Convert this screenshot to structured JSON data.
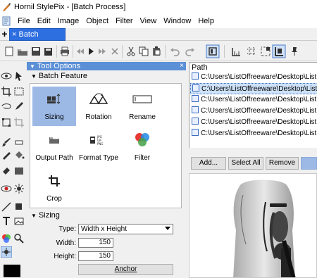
{
  "window": {
    "title": "Hornil StylePix - [Batch Process]"
  },
  "menu": {
    "items": [
      "File",
      "Edit",
      "Image",
      "Object",
      "Filter",
      "View",
      "Window",
      "Help"
    ]
  },
  "tabs": {
    "new_tab": "+",
    "active": "× Batch Process"
  },
  "tool_options": {
    "header": "Tool Options",
    "close": "×",
    "batch_feature_label": "Batch Feature",
    "features": [
      {
        "label": "Sizing",
        "icon": "sizing-icon",
        "selected": true
      },
      {
        "label": "Rotation",
        "icon": "rotation-icon",
        "selected": false
      },
      {
        "label": "Rename",
        "icon": "rename-icon",
        "selected": false
      },
      {
        "label": "Output Path",
        "icon": "folder-icon",
        "selected": false
      },
      {
        "label": "Format Type",
        "icon": "format-icon",
        "selected": false
      },
      {
        "label": "Filter",
        "icon": "filter-icon",
        "selected": false
      },
      {
        "label": "Crop",
        "icon": "crop-icon",
        "selected": false
      }
    ],
    "sizing_label": "Sizing",
    "type_label": "Type:",
    "type_value": "Width x Height",
    "width_label": "Width:",
    "width_value": "150",
    "height_label": "Height:",
    "height_value": "150",
    "anchor_label": "Anchor"
  },
  "file_list": {
    "header": "Path",
    "rows": [
      "C:\\Users\\ListOffreeware\\Desktop\\List",
      "C:\\Users\\ListOffreeware\\Desktop\\List",
      "C:\\Users\\ListOffreeware\\Desktop\\List",
      "C:\\Users\\ListOffreeware\\Desktop\\List",
      "C:\\Users\\ListOffreeware\\Desktop\\List",
      "C:\\Users\\ListOffreeware\\Desktop\\List"
    ],
    "selected_index": 1,
    "add_label": "Add...",
    "select_all_label": "Select All",
    "remove_label": "Remove"
  },
  "colors": {
    "accent": "#2d6ee0",
    "panel_header": "#5b8fd6",
    "selection": "#9cb9e6"
  }
}
